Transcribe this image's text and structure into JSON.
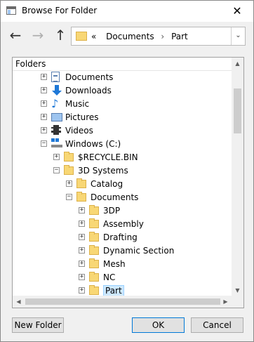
{
  "window": {
    "title": "Browse For Folder",
    "close_glyph": "✕"
  },
  "nav": {
    "back_glyph": "←",
    "forward_glyph": "→",
    "up_glyph": "↑"
  },
  "address": {
    "prefix": "«",
    "segments": [
      "Documents",
      "Part"
    ],
    "separator": "›",
    "dropdown_glyph": "⌄"
  },
  "tree": {
    "header": "Folders",
    "rows": [
      {
        "label": "Documents",
        "icon": "documents-icon",
        "level": 0,
        "expander": "+"
      },
      {
        "label": "Downloads",
        "icon": "downloads-icon",
        "level": 0,
        "expander": "+"
      },
      {
        "label": "Music",
        "icon": "music-icon",
        "level": 0,
        "expander": "+"
      },
      {
        "label": "Pictures",
        "icon": "pictures-icon",
        "level": 0,
        "expander": "+"
      },
      {
        "label": "Videos",
        "icon": "videos-icon",
        "level": 0,
        "expander": "+"
      },
      {
        "label": "Windows (C:)",
        "icon": "drive-icon",
        "level": 0,
        "expander": "−"
      },
      {
        "label": "$RECYCLE.BIN",
        "icon": "folder-icon",
        "level": 1,
        "expander": "+"
      },
      {
        "label": "3D Systems",
        "icon": "folder-icon",
        "level": 1,
        "expander": "−"
      },
      {
        "label": "Catalog",
        "icon": "folder-icon",
        "level": 2,
        "expander": "+"
      },
      {
        "label": "Documents",
        "icon": "folder-icon",
        "level": 2,
        "expander": "−"
      },
      {
        "label": "3DP",
        "icon": "folder-icon",
        "level": 3,
        "expander": "+"
      },
      {
        "label": "Assembly",
        "icon": "folder-icon",
        "level": 3,
        "expander": "+"
      },
      {
        "label": "Drafting",
        "icon": "folder-icon",
        "level": 3,
        "expander": "+"
      },
      {
        "label": "Dynamic Section",
        "icon": "folder-icon",
        "level": 3,
        "expander": "+"
      },
      {
        "label": "Mesh",
        "icon": "folder-icon",
        "level": 3,
        "expander": "+"
      },
      {
        "label": "NC",
        "icon": "folder-icon",
        "level": 3,
        "expander": "+"
      },
      {
        "label": "Part",
        "icon": "folder-icon",
        "level": 3,
        "expander": "+",
        "selected": true
      }
    ]
  },
  "buttons": {
    "new_folder": "New Folder",
    "ok": "OK",
    "cancel": "Cancel"
  },
  "colors": {
    "selection": "#cde8ff",
    "folder": "#f8d775",
    "accent": "#0078d7"
  }
}
